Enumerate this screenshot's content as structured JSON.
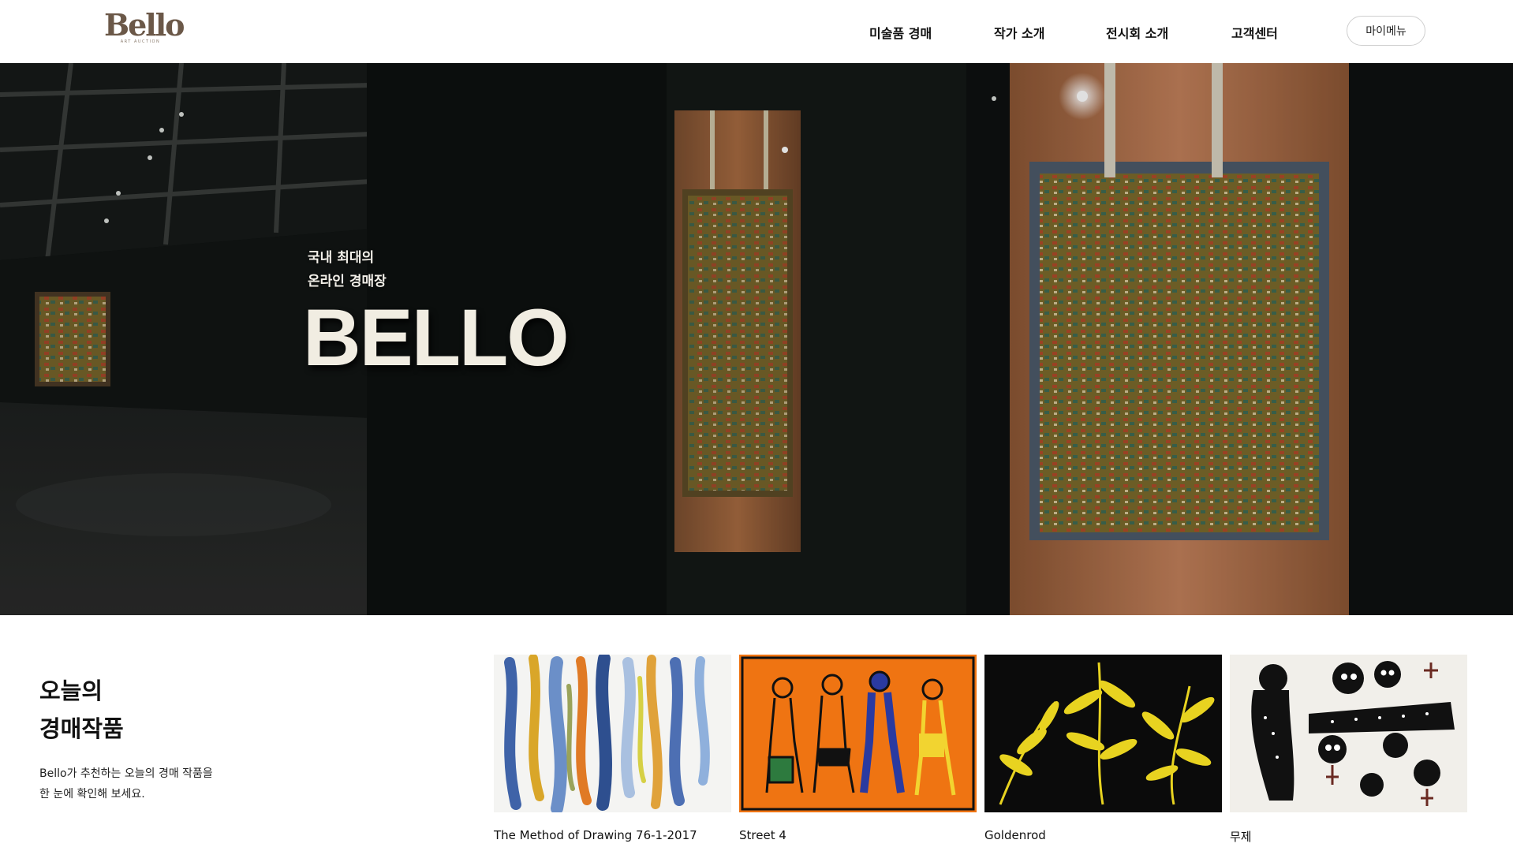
{
  "header": {
    "logo": {
      "text": "Bello",
      "subtext": "ART AUCTION"
    },
    "nav": [
      {
        "label": "미술품 경매"
      },
      {
        "label": "작가 소개"
      },
      {
        "label": "전시회 소개"
      },
      {
        "label": "고객센터"
      }
    ],
    "my_menu_label": "마이메뉴"
  },
  "hero": {
    "subtitle_line1": "국내 최대의",
    "subtitle_line2": "온라인 경매장",
    "title": "BELLO"
  },
  "today": {
    "title_line1": "오늘의",
    "title_line2": "경매작품",
    "desc_line1": "Bello가 추천하는 오늘의 경매 작품을",
    "desc_line2": "한 눈에 확인해 보세요.",
    "artworks": [
      {
        "title": "The Method of Drawing 76-1-2017"
      },
      {
        "title": "Street 4"
      },
      {
        "title": "Goldenrod"
      },
      {
        "title": "무제"
      }
    ]
  }
}
